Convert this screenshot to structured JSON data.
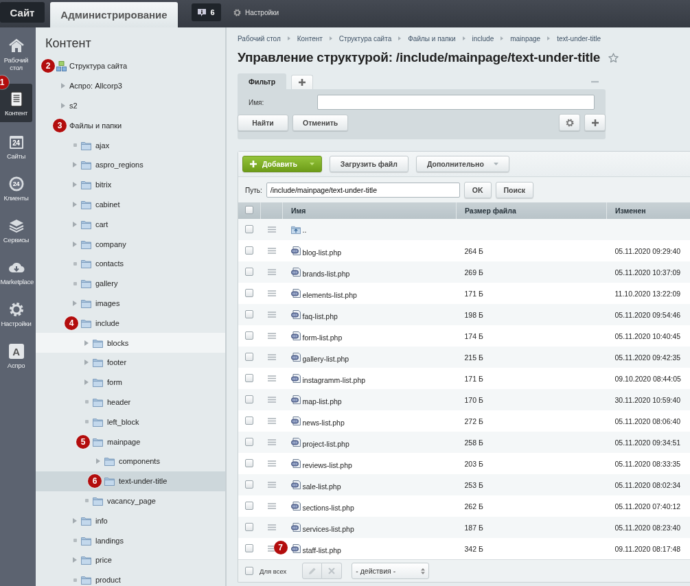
{
  "top_bar": {
    "tabs": [
      {
        "label": "Сайт",
        "selected": false
      },
      {
        "label": "Администрирование",
        "selected": true
      }
    ],
    "notifications": {
      "count": "6"
    },
    "settings": {
      "label": "Настройки"
    }
  },
  "nav": [
    {
      "kind": "home",
      "label": "Рабочий стол",
      "selected": false
    },
    {
      "kind": "content",
      "label": "Контент",
      "selected": true,
      "annotation": "1"
    },
    {
      "kind": "calendar",
      "icon_label": "24",
      "label": "Сайты",
      "selected": false
    },
    {
      "kind": "clients",
      "icon_label": "24",
      "label": "Клиенты",
      "selected": false
    },
    {
      "kind": "layers",
      "label": "Сервисы",
      "selected": false
    },
    {
      "kind": "cloud",
      "label": "Marketplace",
      "selected": false
    },
    {
      "kind": "gear",
      "label": "Настройки",
      "selected": false
    },
    {
      "kind": "letter",
      "icon_label": "A",
      "label": "Аспро",
      "selected": false
    }
  ],
  "tree": {
    "title": "Контент",
    "items": [
      {
        "kind": "site",
        "label": "Структура сайта",
        "leaf": false,
        "expanded": true,
        "selected": false,
        "annotation": "2",
        "children": [
          {
            "kind": "node",
            "label": "Аспро: Allcorp3",
            "leaf": false,
            "expanded": false,
            "selected": false
          },
          {
            "kind": "node",
            "label": "s2",
            "leaf": false,
            "expanded": false,
            "selected": false
          },
          {
            "kind": "node",
            "label": "Файлы и папки",
            "leaf": false,
            "expanded": true,
            "selected": false,
            "annotation": "3",
            "children": [
              {
                "kind": "folder",
                "label": "ajax",
                "leaf": true,
                "selected": false
              },
              {
                "kind": "folder",
                "label": "aspro_regions",
                "leaf": false,
                "expanded": false,
                "selected": false
              },
              {
                "kind": "folder",
                "label": "bitrix",
                "leaf": false,
                "expanded": false,
                "selected": false
              },
              {
                "kind": "folder",
                "label": "cabinet",
                "leaf": false,
                "expanded": false,
                "selected": false
              },
              {
                "kind": "folder",
                "label": "cart",
                "leaf": false,
                "expanded": false,
                "selected": false
              },
              {
                "kind": "folder",
                "label": "company",
                "leaf": false,
                "expanded": false,
                "selected": false
              },
              {
                "kind": "folder",
                "label": "contacts",
                "leaf": true,
                "selected": false
              },
              {
                "kind": "folder",
                "label": "gallery",
                "leaf": true,
                "selected": false
              },
              {
                "kind": "folder",
                "label": "images",
                "leaf": false,
                "expanded": false,
                "selected": false
              },
              {
                "kind": "folder",
                "label": "include",
                "leaf": false,
                "expanded": true,
                "selected": false,
                "annotation": "4",
                "children": [
                  {
                    "kind": "folder",
                    "label": "blocks",
                    "leaf": false,
                    "expanded": false,
                    "selected": false,
                    "hovered": true
                  },
                  {
                    "kind": "folder",
                    "label": "footer",
                    "leaf": false,
                    "expanded": false,
                    "selected": false
                  },
                  {
                    "kind": "folder",
                    "label": "form",
                    "leaf": false,
                    "expanded": false,
                    "selected": false
                  },
                  {
                    "kind": "folder",
                    "label": "header",
                    "leaf": true,
                    "selected": false
                  },
                  {
                    "kind": "folder",
                    "label": "left_block",
                    "leaf": true,
                    "selected": false
                  },
                  {
                    "kind": "folder",
                    "label": "mainpage",
                    "leaf": false,
                    "expanded": true,
                    "selected": false,
                    "annotation": "5",
                    "children": [
                      {
                        "kind": "folder",
                        "label": "components",
                        "leaf": false,
                        "expanded": false,
                        "selected": false
                      },
                      {
                        "kind": "folder",
                        "label": "text-under-title",
                        "leaf": false,
                        "expanded": true,
                        "selected": true,
                        "annotation": "6"
                      }
                    ]
                  },
                  {
                    "kind": "folder",
                    "label": "vacancy_page",
                    "leaf": true,
                    "selected": false
                  }
                ]
              },
              {
                "kind": "folder",
                "label": "info",
                "leaf": false,
                "expanded": false,
                "selected": false
              },
              {
                "kind": "folder",
                "label": "landings",
                "leaf": true,
                "selected": false
              },
              {
                "kind": "folder",
                "label": "price",
                "leaf": false,
                "expanded": false,
                "selected": false
              },
              {
                "kind": "folder",
                "label": "product",
                "leaf": true,
                "selected": false
              }
            ]
          }
        ]
      }
    ]
  },
  "breadcrumbs": [
    "Рабочий стол",
    "Контент",
    "Структура сайта",
    "Файлы и папки",
    "include",
    "mainpage",
    "text-under-title"
  ],
  "page_title": "Управление структурой: /include/mainpage/text-under-title",
  "filter": {
    "tab": {
      "label": "Фильтр",
      "selected": true
    },
    "field_label": "Имя:",
    "buttons": [
      "Найти",
      "Отменить"
    ]
  },
  "toolbar": [
    {
      "kind": "primary",
      "label": "Добавить"
    },
    {
      "kind": "plain",
      "label": "Загрузить файл"
    },
    {
      "kind": "menu",
      "label": "Дополнительно"
    }
  ],
  "path": {
    "label": "Путь:",
    "value": "/include/mainpage/text-under-title",
    "buttons": [
      "OK",
      "Поиск"
    ]
  },
  "table": {
    "checked": false,
    "columns": [
      "Имя",
      "Размер файла",
      "Изменен"
    ],
    "rows": [
      {
        "kind": "up",
        "name": "..",
        "checked": false
      },
      {
        "kind": "file",
        "name": "blog-list.php",
        "size": "264 Б",
        "modified": "05.11.2020 09:29:40",
        "checked": false
      },
      {
        "kind": "file",
        "name": "brands-list.php",
        "size": "269 Б",
        "modified": "05.11.2020 10:37:09",
        "checked": false
      },
      {
        "kind": "file",
        "name": "elements-list.php",
        "size": "171 Б",
        "modified": "11.10.2020 13:22:09",
        "checked": false
      },
      {
        "kind": "file",
        "name": "faq-list.php",
        "size": "198 Б",
        "modified": "05.11.2020 09:54:46",
        "checked": false
      },
      {
        "kind": "file",
        "name": "form-list.php",
        "size": "174 Б",
        "modified": "05.11.2020 10:40:45",
        "checked": false
      },
      {
        "kind": "file",
        "name": "gallery-list.php",
        "size": "215 Б",
        "modified": "05.11.2020 09:42:35",
        "checked": false
      },
      {
        "kind": "file",
        "name": "instagramm-list.php",
        "size": "171 Б",
        "modified": "09.10.2020 08:44:05",
        "checked": false
      },
      {
        "kind": "file",
        "name": "map-list.php",
        "size": "170 Б",
        "modified": "30.11.2020 10:59:40",
        "checked": false
      },
      {
        "kind": "file",
        "name": "news-list.php",
        "size": "272 Б",
        "modified": "05.11.2020 08:06:40",
        "checked": false
      },
      {
        "kind": "file",
        "name": "project-list.php",
        "size": "258 Б",
        "modified": "05.11.2020 09:34:51",
        "checked": false
      },
      {
        "kind": "file",
        "name": "reviews-list.php",
        "size": "203 Б",
        "modified": "05.11.2020 08:33:35",
        "checked": false
      },
      {
        "kind": "file",
        "name": "sale-list.php",
        "size": "253 Б",
        "modified": "05.11.2020 08:02:34",
        "checked": false
      },
      {
        "kind": "file",
        "name": "sections-list.php",
        "size": "262 Б",
        "modified": "05.11.2020 07:40:12",
        "checked": false
      },
      {
        "kind": "file",
        "name": "services-list.php",
        "size": "187 Б",
        "modified": "05.11.2020 08:23:40",
        "checked": false
      },
      {
        "kind": "file",
        "name": "staff-list.php",
        "size": "342 Б",
        "modified": "09.11.2020 08:17:48",
        "checked": false,
        "annotation": "7"
      }
    ]
  },
  "footer": {
    "checked": false,
    "label": "Для всех",
    "action": "- действия -"
  }
}
